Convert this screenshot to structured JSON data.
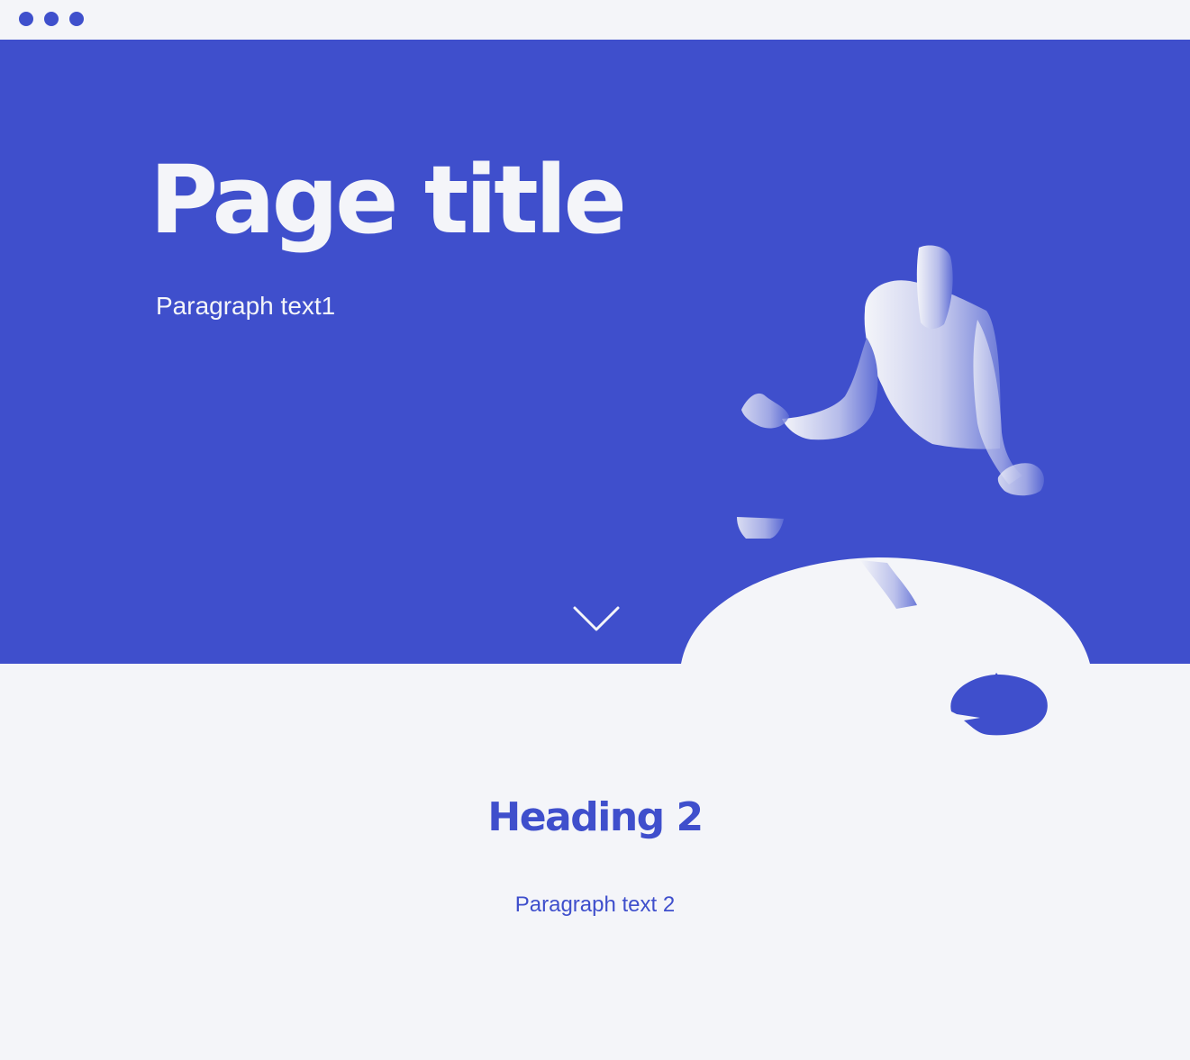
{
  "window": {
    "controls": [
      "window-dot-1",
      "window-dot-2",
      "window-dot-3"
    ]
  },
  "hero": {
    "title": "Page title",
    "paragraph": "Paragraph text1",
    "scroll_icon": "chevron-down-icon"
  },
  "content": {
    "heading": "Heading 2",
    "paragraph": "Paragraph text 2"
  },
  "colors": {
    "primary": "#3f4fcc",
    "background": "#f4f5f9"
  }
}
